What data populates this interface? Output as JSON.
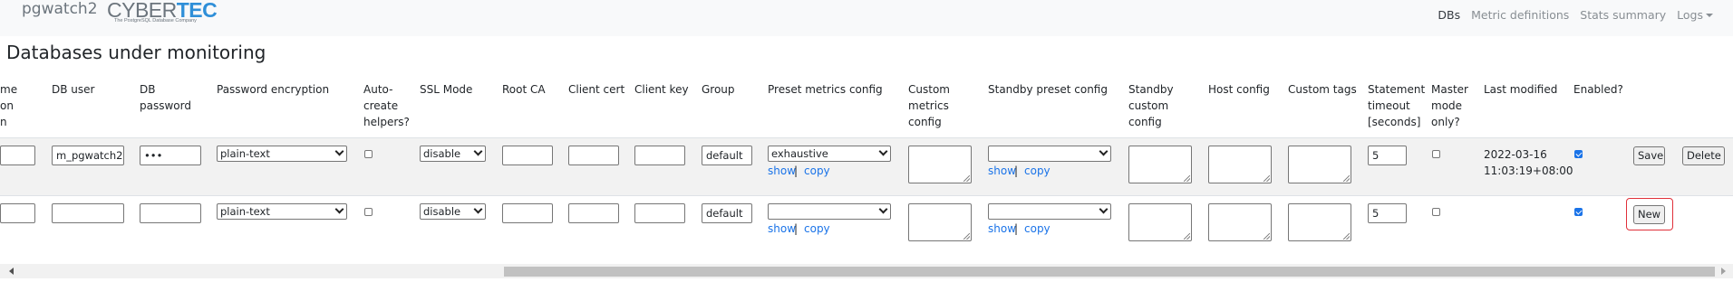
{
  "brand": {
    "name": "pgwatch2",
    "logo_main": "CYBER",
    "logo_accent": "TEC",
    "logo_tagline": "The PostgreSQL Database Company"
  },
  "nav": {
    "dbs": "DBs",
    "metric_definitions": "Metric definitions",
    "stats_summary": "Stats summary",
    "logs": "Logs"
  },
  "page_title": "Databases under monitoring",
  "columns": {
    "name_partial": [
      "me",
      "on",
      "n"
    ],
    "db_user": "DB user",
    "db_password": [
      "DB",
      "password"
    ],
    "password_encryption": "Password encryption",
    "auto_create_helpers": [
      "Auto-",
      "create",
      "helpers?"
    ],
    "ssl_mode": "SSL Mode",
    "root_ca": "Root CA",
    "client_cert": "Client cert",
    "client_key": "Client key",
    "group": "Group",
    "preset_metrics_config": "Preset metrics config",
    "custom_metrics_config": [
      "Custom",
      "metrics",
      "config"
    ],
    "standby_preset_config": "Standby preset config",
    "standby_custom_config": [
      "Standby",
      "custom",
      "config"
    ],
    "host_config": "Host config",
    "custom_tags": "Custom tags",
    "statement_timeout": [
      "Statement",
      "timeout",
      "[seconds]"
    ],
    "master_mode_only": [
      "Master",
      "mode",
      "only?"
    ],
    "last_modified": "Last modified",
    "enabled": "Enabled?"
  },
  "rows": [
    {
      "db_user": "m_pgwatch2",
      "db_password": "•••",
      "password_encryption": "plain-text",
      "ssl_mode": "disable",
      "group": "default",
      "preset_metrics": "exhaustive",
      "standby_preset": "",
      "statement_timeout": "5",
      "last_modified": [
        "2022-03-16",
        "11:03:19+08:00"
      ],
      "enabled": true,
      "master_mode_only": false,
      "auto_create_helpers": false
    },
    {
      "db_user": "",
      "db_password": "",
      "password_encryption": "plain-text",
      "ssl_mode": "disable",
      "group": "default",
      "preset_metrics": "",
      "standby_preset": "",
      "statement_timeout": "5",
      "enabled": true,
      "master_mode_only": false,
      "auto_create_helpers": false
    }
  ],
  "links": {
    "show": "show",
    "copy": "copy",
    "separator": "|"
  },
  "buttons": {
    "save": "Save",
    "delete": "Delete",
    "new": "New"
  },
  "colors": {
    "link": "#1a73e8",
    "highlight": "#e0303a",
    "logo_accent": "#2f8fd8"
  }
}
